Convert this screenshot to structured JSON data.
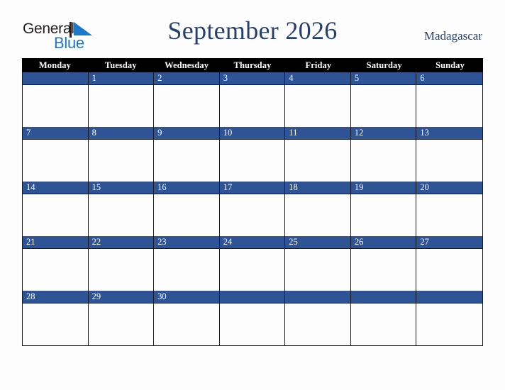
{
  "brand": {
    "name_part1": "General",
    "name_part2": "Blue",
    "mark": "triangle-logo-icon"
  },
  "header": {
    "title": "September 2026",
    "region": "Madagascar"
  },
  "calendar": {
    "month": "September",
    "year": "2026",
    "weekday_headers": [
      "Monday",
      "Tuesday",
      "Wednesday",
      "Thursday",
      "Friday",
      "Saturday",
      "Sunday"
    ],
    "colors": {
      "header_band": "#000000",
      "date_band": "#2e5496",
      "grid_line": "#1a1a1a",
      "cell_body": "#fdfdfd",
      "title_text": "#27406b",
      "brand_blue": "#1a79c9",
      "brand_dark": "#231f20"
    },
    "weeks": [
      [
        "",
        "1",
        "2",
        "3",
        "4",
        "5",
        "6"
      ],
      [
        "7",
        "8",
        "9",
        "10",
        "11",
        "12",
        "13"
      ],
      [
        "14",
        "15",
        "16",
        "17",
        "18",
        "19",
        "20"
      ],
      [
        "21",
        "22",
        "23",
        "24",
        "25",
        "26",
        "27"
      ],
      [
        "28",
        "29",
        "30",
        "",
        "",
        "",
        ""
      ]
    ]
  }
}
